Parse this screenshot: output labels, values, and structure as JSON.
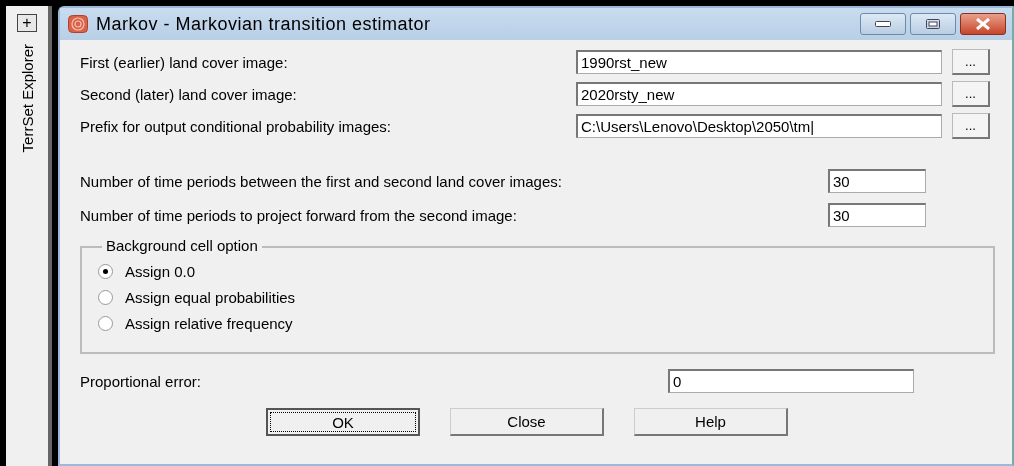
{
  "sidebar": {
    "expand_button": "+",
    "title": "TerrSet Explorer"
  },
  "window": {
    "title": "Markov - Markovian transition estimator"
  },
  "file_fields": [
    {
      "label": "First (earlier) land cover image:",
      "value": "1990rst_new",
      "browse": "..."
    },
    {
      "label": "Second (later) land cover image:",
      "value": "2020rsty_new",
      "browse": "..."
    },
    {
      "label": "Prefix for output conditional probability images:",
      "value": "C:\\Users\\Lenovo\\Desktop\\2050\\tm|",
      "browse": "..."
    }
  ],
  "number_fields": [
    {
      "label": "Number of time periods between the first and second land cover images:",
      "value": "30"
    },
    {
      "label": "Number of time periods to project forward from the second image:",
      "value": "30"
    }
  ],
  "background_option": {
    "title": "Background cell option",
    "options": [
      {
        "label": "Assign 0.0",
        "selected": true
      },
      {
        "label": "Assign equal probabilities",
        "selected": false
      },
      {
        "label": "Assign relative frequency",
        "selected": false
      }
    ]
  },
  "proportional_error": {
    "label": "Proportional error:",
    "value": "0"
  },
  "buttons": [
    {
      "label": "OK",
      "focused": true
    },
    {
      "label": "Close",
      "focused": false
    },
    {
      "label": "Help",
      "focused": false
    }
  ]
}
